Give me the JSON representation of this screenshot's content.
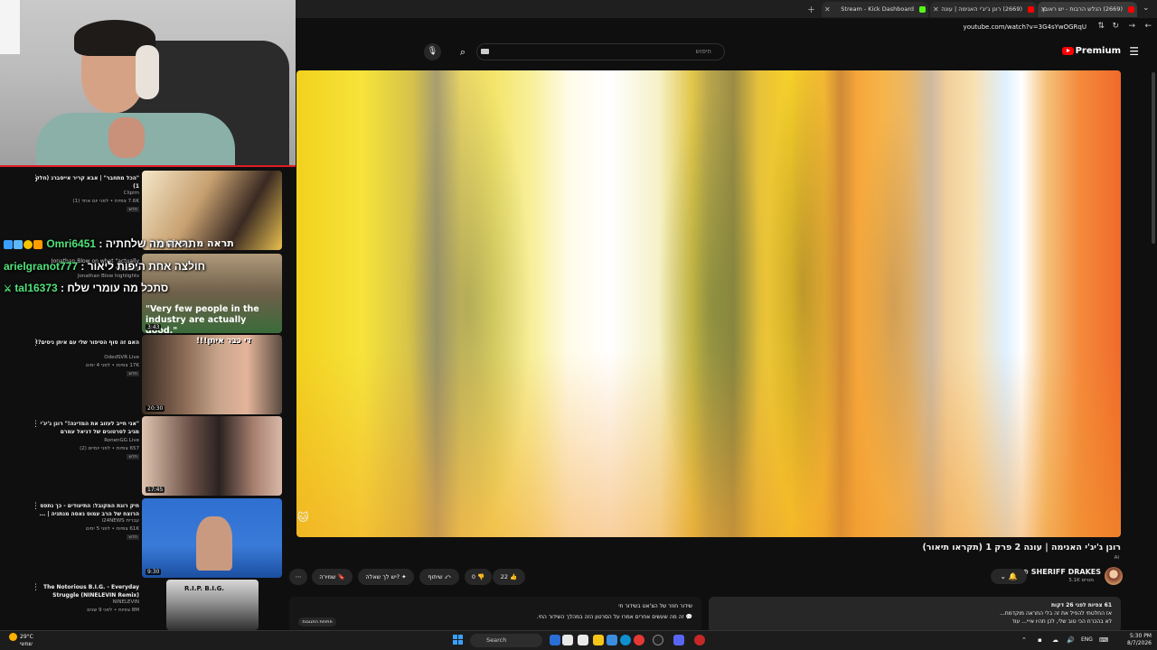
{
  "browser": {
    "tabs": [
      {
        "label": "Stream - Kick Dashboard",
        "color": "#53fc18"
      },
      {
        "label": "(2669) רונן ג'יג'י האנימה | עונה",
        "color": "#ff0000"
      },
      {
        "label": "(2669) הנלש הרבות - יש ראובן",
        "color": "#ff0000"
      }
    ],
    "url": "youtube.com/watch?v=3G4sYwOGRqU"
  },
  "youtube": {
    "search_placeholder": "חיפוש",
    "premium_label": "Premium",
    "video": {
      "title": "רונן ג'יג'י האנימה | עונה 2 פרק 1 (תקראו תיאור)",
      "ai_badge": "AI",
      "channel": "SHERIFF DRAKES",
      "subscribers": "5.1K מנויים",
      "likes": "22",
      "dislikes": "0",
      "share_label": "שיתוף",
      "ask_label": "יש לך שאלה?",
      "save_label": "שמירה",
      "more_label": "⋯"
    },
    "description": {
      "line1": "61 צפיות  לפני 26 דקות",
      "line2": "אז החלטתי להפיל את זה בלי התראה מוקדמת...",
      "line3": "לא בהכרח הכי טוב שלי, לכן תהיו אייי... עוד"
    },
    "chat": {
      "line1": "שידור חוזר של הצ'אט בשידור חי",
      "line2": "זה מה שעשים אחרים אמרו על הסרטון הזה במהלך השידור החי.",
      "open_label": "פתיחת התגובות"
    }
  },
  "sidebar": {
    "recommendations": [
      {
        "title": "\"הכל מתחבר\" | אבא קריר אייסברג (חלק 1)",
        "channel": "Clipim",
        "meta": "7.6K צפיות • לפני יום אחד (1)",
        "badge": "חדש",
        "duration": ""
      },
      {
        "title": "Jonathan Blow on what \"actually matters\"",
        "channel": "Jonathan Blow highlights",
        "meta": "",
        "badge": "",
        "duration": "3:43"
      },
      {
        "title": "האם זה סוף הסיפור שלי עם איתן ניסים?!",
        "channel": "OdedSVR Live",
        "meta": "17K צפיות • לפני 4 ימים",
        "badge": "חדש",
        "duration": "20:30"
      },
      {
        "title": "\"אני חייב לעזוב את המדינה!\" רונן ג'יג'י מגיב לסרטונים של דניאל עמרם",
        "channel": "RonenGG Live",
        "meta": "657 צפיות • לפני יומיים (2)",
        "badge": "חדש",
        "duration": "17:45"
      },
      {
        "title": "חיק רונת המקובל: התיעודים - כך נתפס הרוצח של הרב עמוס גאסה מנתניה | ...",
        "channel": "i24NEWS עברית",
        "meta": "61K צפיות • לפני 5 ימים",
        "badge": "חדש",
        "duration": "9:30"
      },
      {
        "title": "The Notorious B.I.G. - Everyday Struggle (NINELEVIN Remix)",
        "channel": "NINELEVIN",
        "meta": "8M צפיות • לפני 9 שנים",
        "badge": "",
        "duration": ""
      }
    ],
    "thumb_texts": [
      "תראה מה שלחתיה",
      "\"Very few people in the industry are actually good.\"",
      "די כבר איתן!!!",
      "R.I.P. B.I.G."
    ]
  },
  "chat_overlay": [
    {
      "user": "Omri6451",
      "message": "תראה מה שלחתיה"
    },
    {
      "user": "arielgranot777",
      "message": "חולצה אחת היפות ליאור"
    },
    {
      "user": "tal16373",
      "message": "סתכל מה עומרי שלח"
    }
  ],
  "taskbar": {
    "temp": "29°C",
    "weather": "שמשי",
    "search_label": "Search",
    "lang": "ENG",
    "time": "5:30 PM",
    "date": "8/7/2026"
  }
}
